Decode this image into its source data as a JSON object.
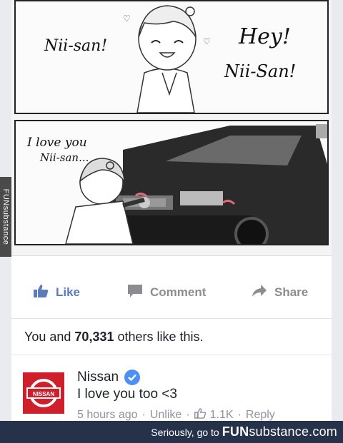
{
  "comic": {
    "panel1": {
      "speech_left": "Nii-san!",
      "speech_right_line1": "Hey!",
      "speech_right_line2": "Nii-San!"
    },
    "panel2": {
      "speech_line1": "I love you",
      "speech_line2": "Nii-san..."
    }
  },
  "watermark": "FUNsubstance",
  "actions": {
    "like": "Like",
    "comment": "Comment",
    "share": "Share"
  },
  "likes": {
    "prefix": "You and",
    "count": "70,331",
    "suffix": "others like this."
  },
  "comment": {
    "author": "Nissan",
    "logo_text": "NISSAN",
    "text": "I love you too <3",
    "time": "5 hours ago",
    "unlike": "Unlike",
    "like_count": "1.1K",
    "reply": "Reply",
    "sep": "·"
  },
  "footer": {
    "text": "Seriously, go to",
    "brand_bold": "FUN",
    "brand_rest": "substance.com"
  },
  "colors": {
    "facebook_blue": "#5b7bbd",
    "nissan_red": "#cf1f2a",
    "verified_blue": "#4c8ff6",
    "footer_bg": "#26324a"
  }
}
